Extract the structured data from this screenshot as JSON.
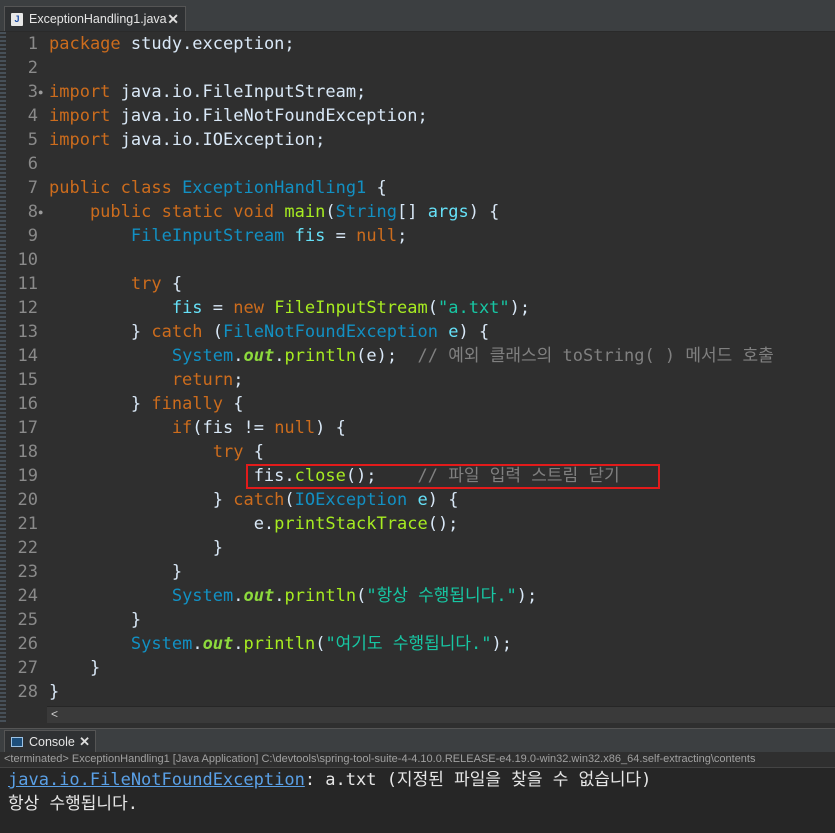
{
  "editor_tab": {
    "icon": "J",
    "title": "ExceptionHandling1.java",
    "close": "✕"
  },
  "code_lines": [
    [
      {
        "t": "package ",
        "c": "kw"
      },
      {
        "t": "study.exception;",
        "c": ""
      }
    ],
    [],
    [
      {
        "t": "import ",
        "c": "kw"
      },
      {
        "t": "java.io.FileInputStream;",
        "c": ""
      }
    ],
    [
      {
        "t": "import ",
        "c": "kw"
      },
      {
        "t": "java.io.FileNotFoundException;",
        "c": ""
      }
    ],
    [
      {
        "t": "import ",
        "c": "kw"
      },
      {
        "t": "java.io.IOException;",
        "c": ""
      }
    ],
    [],
    [
      {
        "t": "public class ",
        "c": "kw"
      },
      {
        "t": "ExceptionHandling1",
        "c": "ty"
      },
      {
        "t": " {",
        "c": ""
      }
    ],
    [
      {
        "t": "    public static void ",
        "c": "kw"
      },
      {
        "t": "main",
        "c": "fn"
      },
      {
        "t": "(",
        "c": ""
      },
      {
        "t": "String",
        "c": "ty"
      },
      {
        "t": "[] ",
        "c": ""
      },
      {
        "t": "args",
        "c": "vr"
      },
      {
        "t": ") {",
        "c": ""
      }
    ],
    [
      {
        "t": "        ",
        "c": ""
      },
      {
        "t": "FileInputStream",
        "c": "ty"
      },
      {
        "t": " ",
        "c": ""
      },
      {
        "t": "fis",
        "c": "vr"
      },
      {
        "t": " = ",
        "c": ""
      },
      {
        "t": "null",
        "c": "kw"
      },
      {
        "t": ";",
        "c": ""
      }
    ],
    [],
    [
      {
        "t": "        try",
        "c": "kw"
      },
      {
        "t": " {",
        "c": ""
      }
    ],
    [
      {
        "t": "            ",
        "c": ""
      },
      {
        "t": "fis",
        "c": "vr"
      },
      {
        "t": " = ",
        "c": ""
      },
      {
        "t": "new ",
        "c": "kw"
      },
      {
        "t": "FileInputStream",
        "c": "fn"
      },
      {
        "t": "(",
        "c": ""
      },
      {
        "t": "\"a.txt\"",
        "c": "st"
      },
      {
        "t": ");",
        "c": ""
      }
    ],
    [
      {
        "t": "        } ",
        "c": ""
      },
      {
        "t": "catch",
        "c": "kw"
      },
      {
        "t": " (",
        "c": ""
      },
      {
        "t": "FileNotFoundException",
        "c": "ty"
      },
      {
        "t": " ",
        "c": ""
      },
      {
        "t": "e",
        "c": "vr"
      },
      {
        "t": ") {",
        "c": ""
      }
    ],
    [
      {
        "t": "            ",
        "c": ""
      },
      {
        "t": "System",
        "c": "ty"
      },
      {
        "t": ".",
        "c": ""
      },
      {
        "t": "out",
        "c": "fld"
      },
      {
        "t": ".",
        "c": ""
      },
      {
        "t": "println",
        "c": "fn"
      },
      {
        "t": "(e);  ",
        "c": ""
      },
      {
        "t": "// 예외 클래스의 toString( ) 메서드 호출",
        "c": "cm"
      }
    ],
    [
      {
        "t": "            return",
        "c": "kw"
      },
      {
        "t": ";",
        "c": ""
      }
    ],
    [
      {
        "t": "        } ",
        "c": ""
      },
      {
        "t": "finally",
        "c": "kw"
      },
      {
        "t": " {",
        "c": ""
      }
    ],
    [
      {
        "t": "            if",
        "c": "kw"
      },
      {
        "t": "(fis != ",
        "c": ""
      },
      {
        "t": "null",
        "c": "kw"
      },
      {
        "t": ") {",
        "c": ""
      }
    ],
    [
      {
        "t": "                try",
        "c": "kw"
      },
      {
        "t": " {",
        "c": ""
      }
    ],
    [
      {
        "t": "                    fis.",
        "c": ""
      },
      {
        "t": "close",
        "c": "fn"
      },
      {
        "t": "();    ",
        "c": ""
      },
      {
        "t": "// 파일 입력 스트림 닫기",
        "c": "cm"
      }
    ],
    [
      {
        "t": "                } ",
        "c": ""
      },
      {
        "t": "catch",
        "c": "kw"
      },
      {
        "t": "(",
        "c": ""
      },
      {
        "t": "IOException",
        "c": "ty"
      },
      {
        "t": " ",
        "c": ""
      },
      {
        "t": "e",
        "c": "vr"
      },
      {
        "t": ") {",
        "c": ""
      }
    ],
    [
      {
        "t": "                    e.",
        "c": ""
      },
      {
        "t": "printStackTrace",
        "c": "fn"
      },
      {
        "t": "();",
        "c": ""
      }
    ],
    [
      {
        "t": "                }",
        "c": ""
      }
    ],
    [
      {
        "t": "            }",
        "c": ""
      }
    ],
    [
      {
        "t": "            ",
        "c": ""
      },
      {
        "t": "System",
        "c": "ty"
      },
      {
        "t": ".",
        "c": ""
      },
      {
        "t": "out",
        "c": "fld"
      },
      {
        "t": ".",
        "c": ""
      },
      {
        "t": "println",
        "c": "fn"
      },
      {
        "t": "(",
        "c": ""
      },
      {
        "t": "\"항상 수행됩니다.\"",
        "c": "st"
      },
      {
        "t": ");",
        "c": ""
      }
    ],
    [
      {
        "t": "        }",
        "c": ""
      }
    ],
    [
      {
        "t": "        ",
        "c": ""
      },
      {
        "t": "System",
        "c": "ty"
      },
      {
        "t": ".",
        "c": ""
      },
      {
        "t": "out",
        "c": "fld"
      },
      {
        "t": ".",
        "c": ""
      },
      {
        "t": "println",
        "c": "fn"
      },
      {
        "t": "(",
        "c": ""
      },
      {
        "t": "\"여기도 수행됩니다.\"",
        "c": "st"
      },
      {
        "t": ");",
        "c": ""
      }
    ],
    [
      {
        "t": "    }",
        "c": ""
      }
    ],
    [
      {
        "t": "}",
        "c": ""
      }
    ]
  ],
  "fold_markers": {
    "3": "●",
    "8": "●"
  },
  "hscroll_arrow": "<",
  "console": {
    "tab_label": "Console",
    "close": "✕",
    "status": "<terminated> ExceptionHandling1 [Java Application] C:\\devtools\\spring-tool-suite-4-4.10.0.RELEASE-e4.19.0-win32.win32.x86_64.self-extracting\\contents",
    "output": [
      {
        "link": "java.io.FileNotFoundException",
        "rest": ": a.txt (지정된 파일을 찾을 수 없습니다)"
      },
      {
        "link": "",
        "rest": "항상 수행됩니다."
      }
    ]
  },
  "colors": {
    "keyword": "#cc6c1d",
    "type": "#1290c3",
    "method": "#a7ec21",
    "string": "#17c6a3",
    "comment": "#808080",
    "highlight_box": "#e21b1b"
  }
}
